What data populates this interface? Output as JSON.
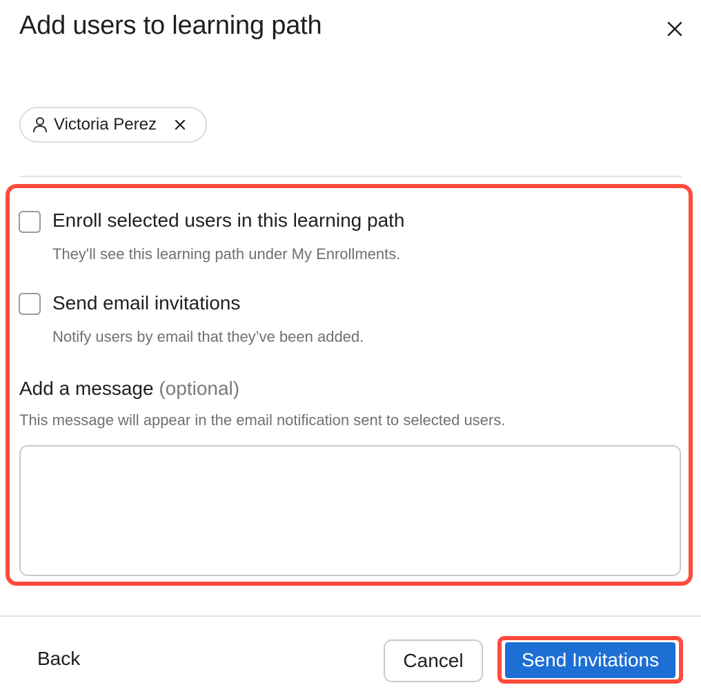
{
  "dialog": {
    "title": "Add users to learning path"
  },
  "selected_users": [
    {
      "name": "Victoria Perez"
    }
  ],
  "options": [
    {
      "label": "Enroll selected users in this learning path",
      "help": "They'll see this learning path under My Enrollments.",
      "checked": false
    },
    {
      "label": "Send email invitations",
      "help": "Notify users by email that they’ve been added.",
      "checked": false
    }
  ],
  "message": {
    "label": "Add a message",
    "optional": "(optional)",
    "help": "This message will appear in the email notification sent to selected users.",
    "value": ""
  },
  "footer": {
    "back_label": "Back",
    "cancel_label": "Cancel",
    "send_label": "Send Invitations"
  },
  "icons": {
    "close": "close-icon",
    "person": "person-icon",
    "remove": "close-icon"
  },
  "colors": {
    "primary": "#1e6fd4",
    "highlight": "#ff4a3d"
  }
}
